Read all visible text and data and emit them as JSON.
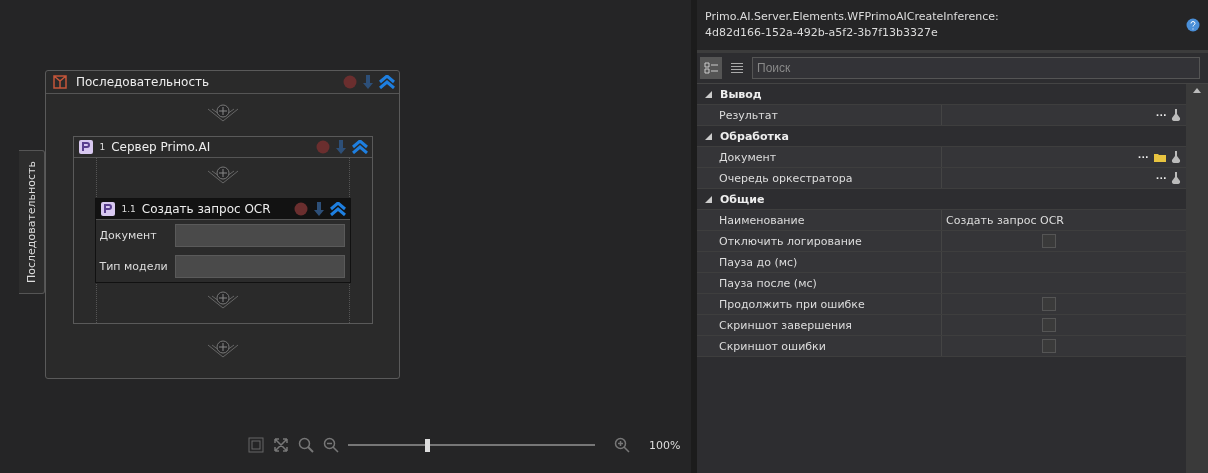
{
  "designer": {
    "side_tab": "Последовательность",
    "sequence": {
      "kind": "sequence",
      "title": "Последовательность",
      "children": [
        {
          "kind": "container",
          "index": "1",
          "title": "Сервер Primo.AI",
          "children": [
            {
              "kind": "activity",
              "index": "1.1",
              "title": "Создать запрос OCR",
              "fields": [
                {
                  "label": "Документ"
                },
                {
                  "label": "Тип модели"
                }
              ]
            }
          ]
        }
      ]
    },
    "zoom": {
      "level": 0.32,
      "reading": "100%"
    }
  },
  "properties": {
    "title": "Primo.AI.Server.Elements.WFPrimoAICreateInference:",
    "subtitle": "4d82d166-152a-492b-a5f2-3b7f13b3327e",
    "view_modes": [
      {
        "selected": true
      },
      {
        "selected": false
      }
    ],
    "search": {
      "placeholder": "Поиск"
    },
    "categories": [
      {
        "name": "Вывод",
        "expanded": true,
        "rows": [
          {
            "label": "Результат",
            "kind": "expression",
            "ellipsis": "···",
            "browse": false
          }
        ]
      },
      {
        "name": "Обработка",
        "expanded": true,
        "rows": [
          {
            "label": "Документ",
            "kind": "expression",
            "ellipsis": "···",
            "browse": true
          },
          {
            "label": "Очередь оркестратора",
            "kind": "expression",
            "ellipsis": "···",
            "browse": false
          }
        ]
      },
      {
        "name": "Общие",
        "expanded": true,
        "rows": [
          {
            "label": "Наименование",
            "kind": "text",
            "value": "Создать запрос OCR"
          },
          {
            "label": "Отключить логирование",
            "kind": "checkbox",
            "checked": false
          },
          {
            "label": "Пауза до (мс)",
            "kind": "text"
          },
          {
            "label": "Пауза после (мс)",
            "kind": "text"
          },
          {
            "label": "Продолжить при ошибке",
            "kind": "checkbox",
            "checked": false
          },
          {
            "label": "Скриншот завершения",
            "kind": "checkbox",
            "checked": false
          },
          {
            "label": "Скриншот ошибки",
            "kind": "checkbox",
            "checked": false
          }
        ]
      }
    ]
  }
}
